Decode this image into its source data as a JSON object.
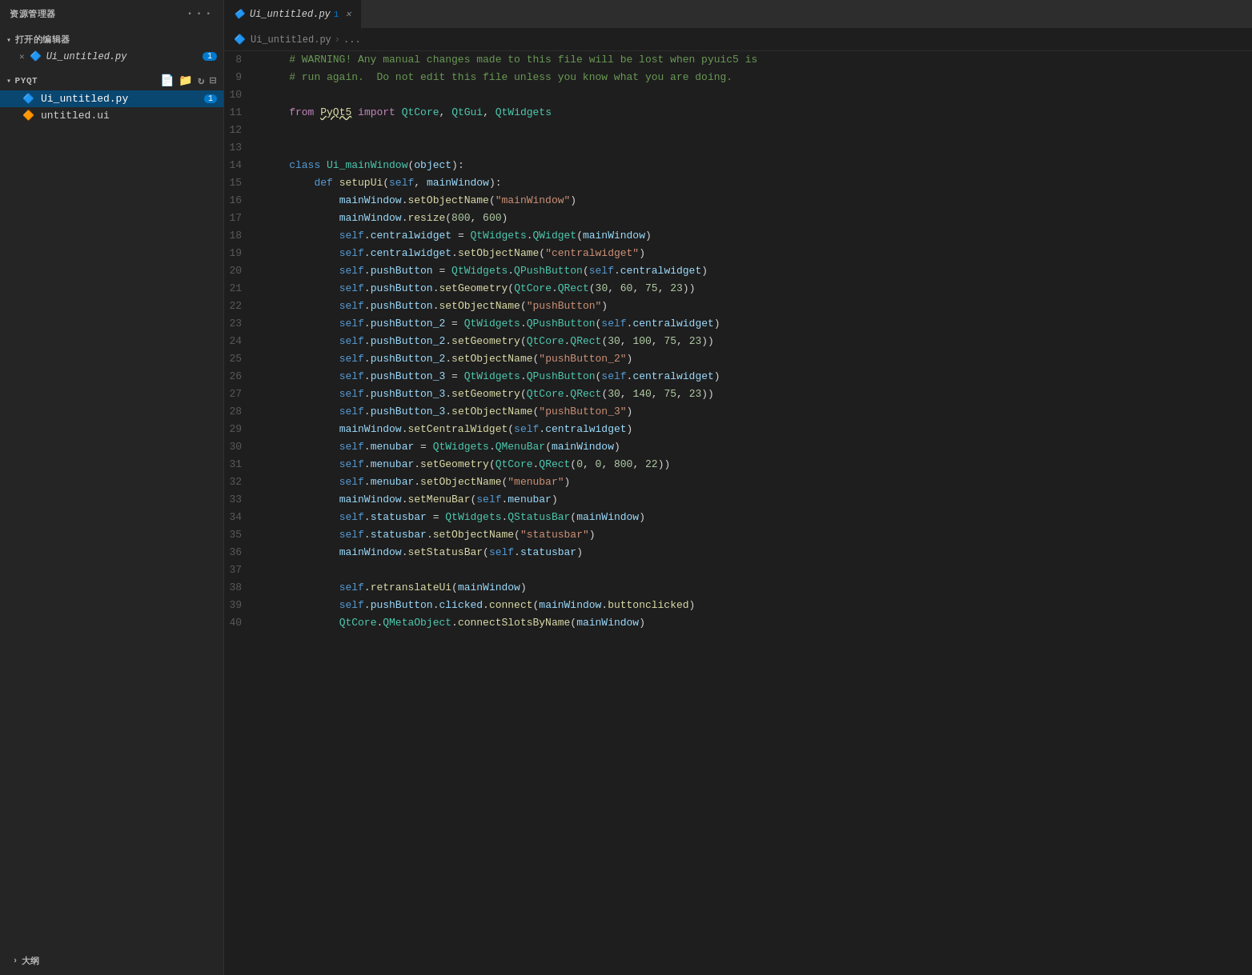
{
  "sidebar": {
    "title": "资源管理器",
    "dots": "···",
    "open_editors_label": "打开的编辑器",
    "open_file_name": "Ui_untitled.py",
    "open_file_badge": "1",
    "pyqt_label": "PYQT",
    "files": [
      {
        "name": "Ui_untitled.py",
        "type": "py",
        "badge": "1",
        "active": true
      },
      {
        "name": "untitled.ui",
        "type": "ui",
        "badge": "",
        "active": false
      }
    ],
    "outline_label": "大纲"
  },
  "tab": {
    "name": "Ui_untitled.py",
    "badge": "1",
    "path": "Ui_untitled.py",
    "breadcrumb_sep": "..."
  },
  "code": {
    "lines": [
      {
        "num": 8,
        "content": "comment_line"
      },
      {
        "num": 9,
        "content": "empty"
      },
      {
        "num": 10,
        "content": "empty"
      },
      {
        "num": 11,
        "content": "from_import"
      },
      {
        "num": 12,
        "content": "empty"
      },
      {
        "num": 13,
        "content": "empty"
      },
      {
        "num": 14,
        "content": "class_def"
      },
      {
        "num": 15,
        "content": "def_setupUi"
      },
      {
        "num": 16,
        "content": "setObjectName_mainWindow"
      },
      {
        "num": 17,
        "content": "resize"
      },
      {
        "num": 18,
        "content": "centralwidget_assign"
      },
      {
        "num": 19,
        "content": "centralwidget_setObjName"
      },
      {
        "num": 20,
        "content": "pushButton_assign"
      },
      {
        "num": 21,
        "content": "pushButton_setGeometry"
      },
      {
        "num": 22,
        "content": "pushButton_setObjName"
      },
      {
        "num": 23,
        "content": "pushButton2_assign"
      },
      {
        "num": 24,
        "content": "pushButton2_setGeometry"
      },
      {
        "num": 25,
        "content": "pushButton2_setObjName"
      },
      {
        "num": 26,
        "content": "pushButton3_assign"
      },
      {
        "num": 27,
        "content": "pushButton3_setGeometry"
      },
      {
        "num": 28,
        "content": "pushButton3_setObjName"
      },
      {
        "num": 29,
        "content": "setCentralWidget"
      },
      {
        "num": 30,
        "content": "menubar_assign"
      },
      {
        "num": 31,
        "content": "menubar_setGeometry"
      },
      {
        "num": 32,
        "content": "menubar_setObjName"
      },
      {
        "num": 33,
        "content": "setMenuBar"
      },
      {
        "num": 34,
        "content": "statusbar_assign"
      },
      {
        "num": 35,
        "content": "statusbar_setObjName"
      },
      {
        "num": 36,
        "content": "setStatusBar"
      },
      {
        "num": 37,
        "content": "empty"
      },
      {
        "num": 38,
        "content": "retranslateUi"
      },
      {
        "num": 39,
        "content": "connect_clicked"
      },
      {
        "num": 40,
        "content": "connectSlotsByName"
      }
    ]
  }
}
